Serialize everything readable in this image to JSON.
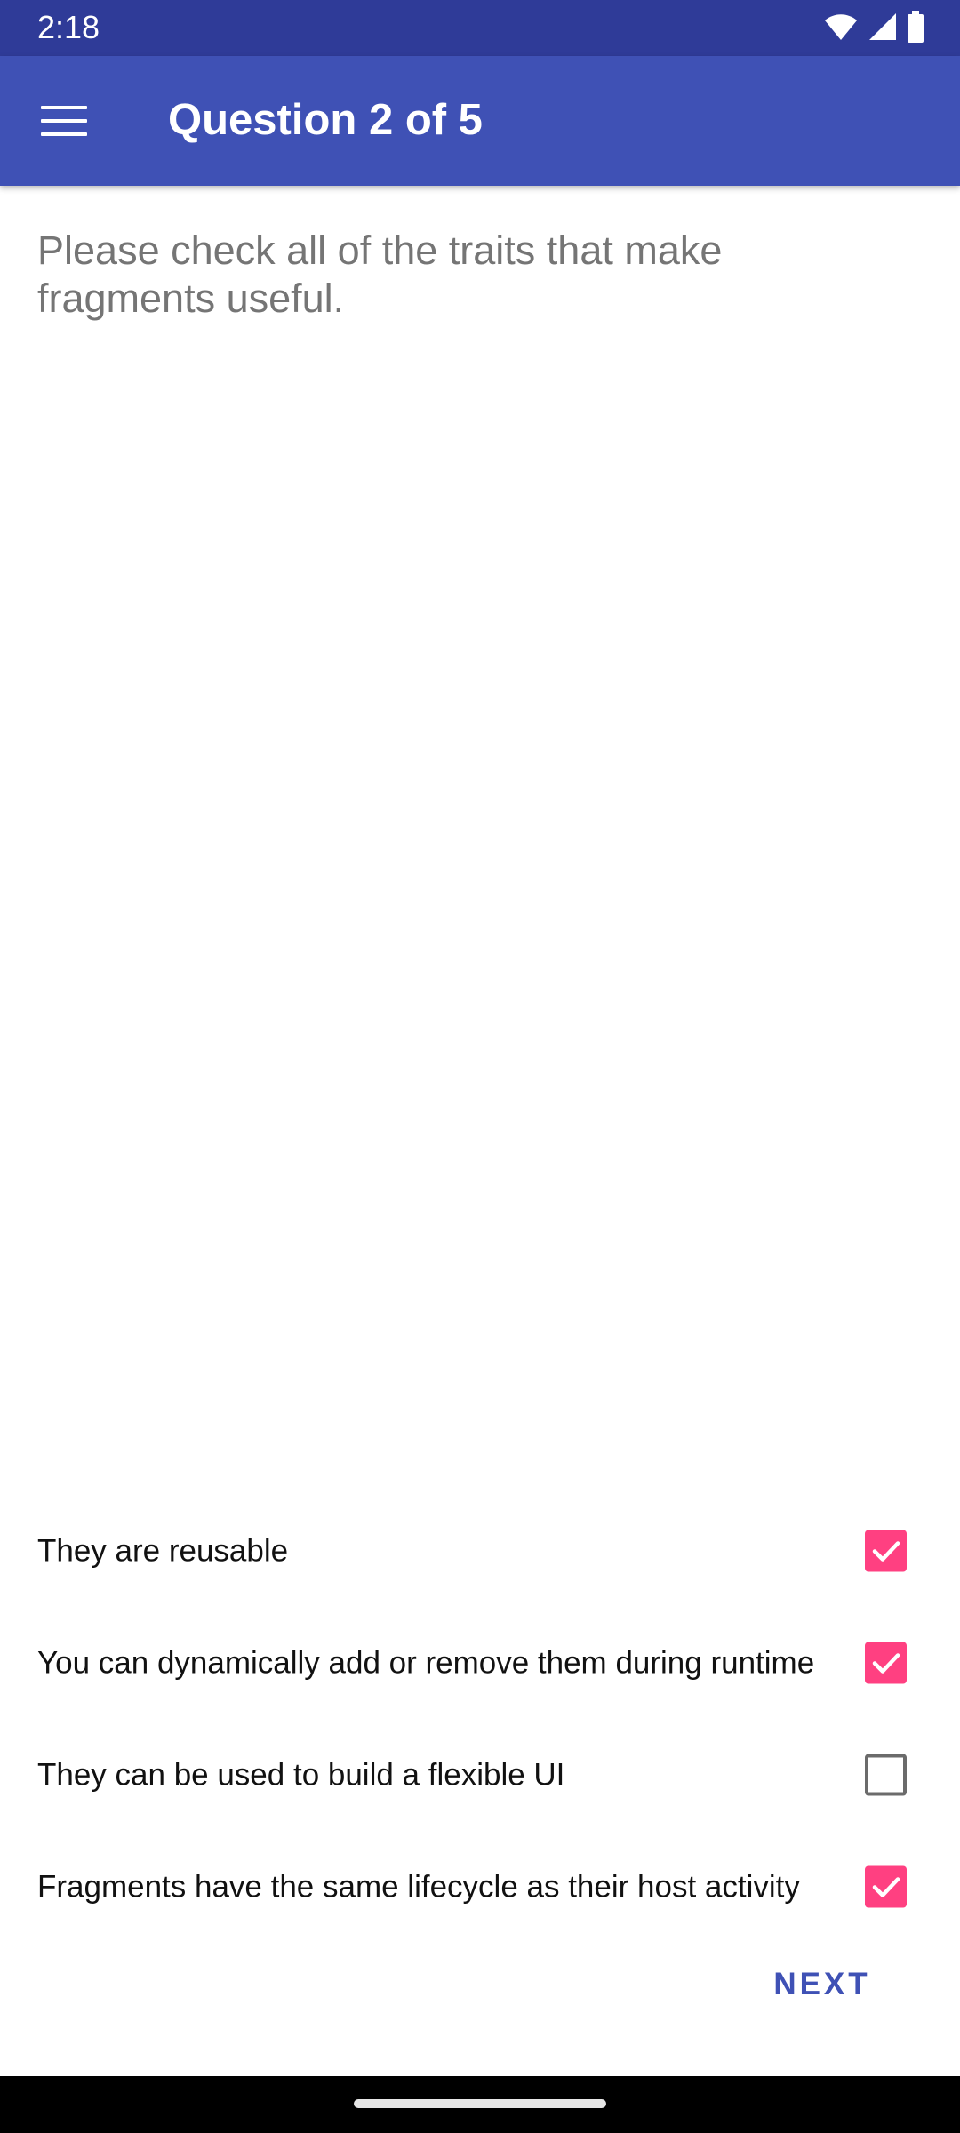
{
  "status_bar": {
    "time": "2:18",
    "icons": [
      "wifi-icon",
      "signal-icon",
      "battery-icon"
    ]
  },
  "app_bar": {
    "title": "Question 2 of 5",
    "menu_icon": "hamburger-menu-icon"
  },
  "question": {
    "text": "Please check all of the traits that make fragments useful."
  },
  "options": [
    {
      "label": "They are reusable",
      "checked": true
    },
    {
      "label": "You can dynamically add or remove them during runtime",
      "checked": true
    },
    {
      "label": "They can be used to build a flexible UI",
      "checked": false
    },
    {
      "label": "Fragments have the same lifecycle as their host activity",
      "checked": true
    }
  ],
  "actions": {
    "next_label": "NEXT"
  },
  "colors": {
    "status_bar": "#2f3b98",
    "app_bar": "#3f51b5",
    "accent": "#ff4081",
    "question_text": "#757575"
  }
}
